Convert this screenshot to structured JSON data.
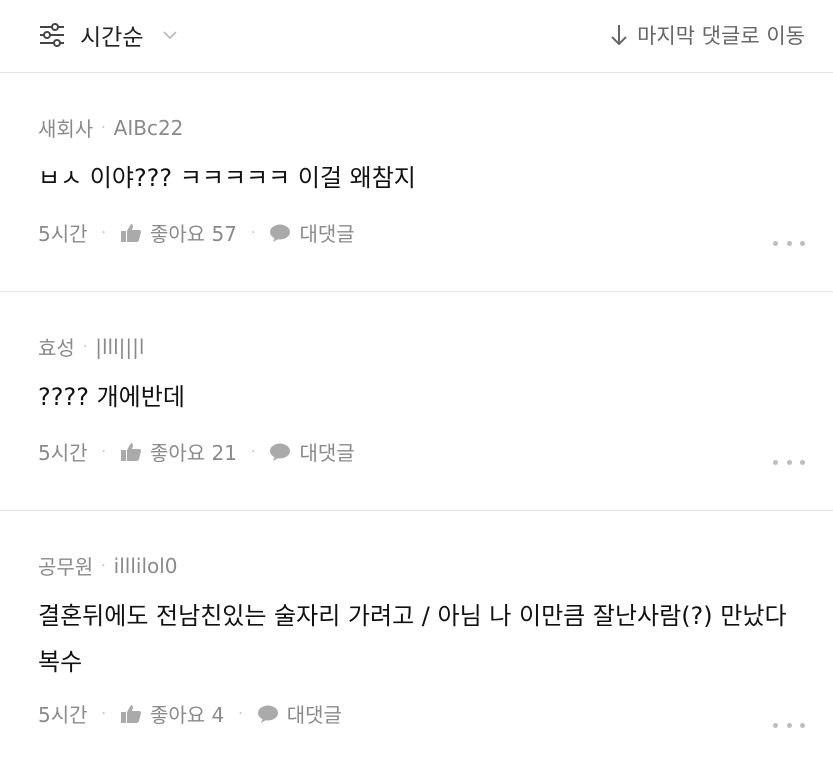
{
  "toolbar": {
    "sort_label": "시간순",
    "jump_label": "마지막 댓글로 이동"
  },
  "comments": [
    {
      "author": "새회사",
      "nickname": "AIBc22",
      "text": "ㅂㅅ 이야??? ㅋㅋㅋㅋㅋ 이걸 왜참지",
      "time": "5시간",
      "likes": "좋아요 57",
      "reply": "대댓글"
    },
    {
      "author": "효성",
      "nickname": "|lll|||l",
      "text": "???? 개에반데",
      "time": "5시간",
      "likes": "좋아요 21",
      "reply": "대댓글"
    },
    {
      "author": "공무원",
      "nickname": "illlilol0",
      "text": "결혼뒤에도 전남친있는 술자리 가려고 / 아님 나 이만큼 잘난사람(?) 만났다 복수",
      "time": "5시간",
      "likes": "좋아요 4",
      "reply": "대댓글"
    }
  ],
  "icons": {
    "sort": "sliders-icon",
    "chevron": "chevron-down-icon",
    "arrow": "arrow-down-icon",
    "like": "thumbs-up-icon",
    "reply": "speech-bubble-icon",
    "more": "more-dots-icon"
  }
}
